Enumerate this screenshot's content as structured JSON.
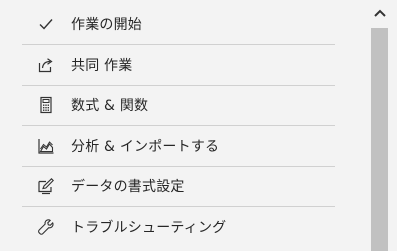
{
  "menu": {
    "items": [
      {
        "label": "作業の開始",
        "icon": "checkmark-icon"
      },
      {
        "label": "共同 作業",
        "icon": "share-icon"
      },
      {
        "label": "数式 & 関数",
        "icon": "calculator-icon"
      },
      {
        "label": "分析 & インポートする",
        "icon": "area-chart-icon"
      },
      {
        "label": "データの書式設定",
        "icon": "format-edit-icon"
      },
      {
        "label": "トラブルシューティング",
        "icon": "wrench-icon"
      }
    ]
  },
  "scrollbar": {
    "up_icon": "chevron-up-icon",
    "colors": {
      "thumb": "#c1c1c1",
      "track": "#f3f3f3"
    }
  }
}
